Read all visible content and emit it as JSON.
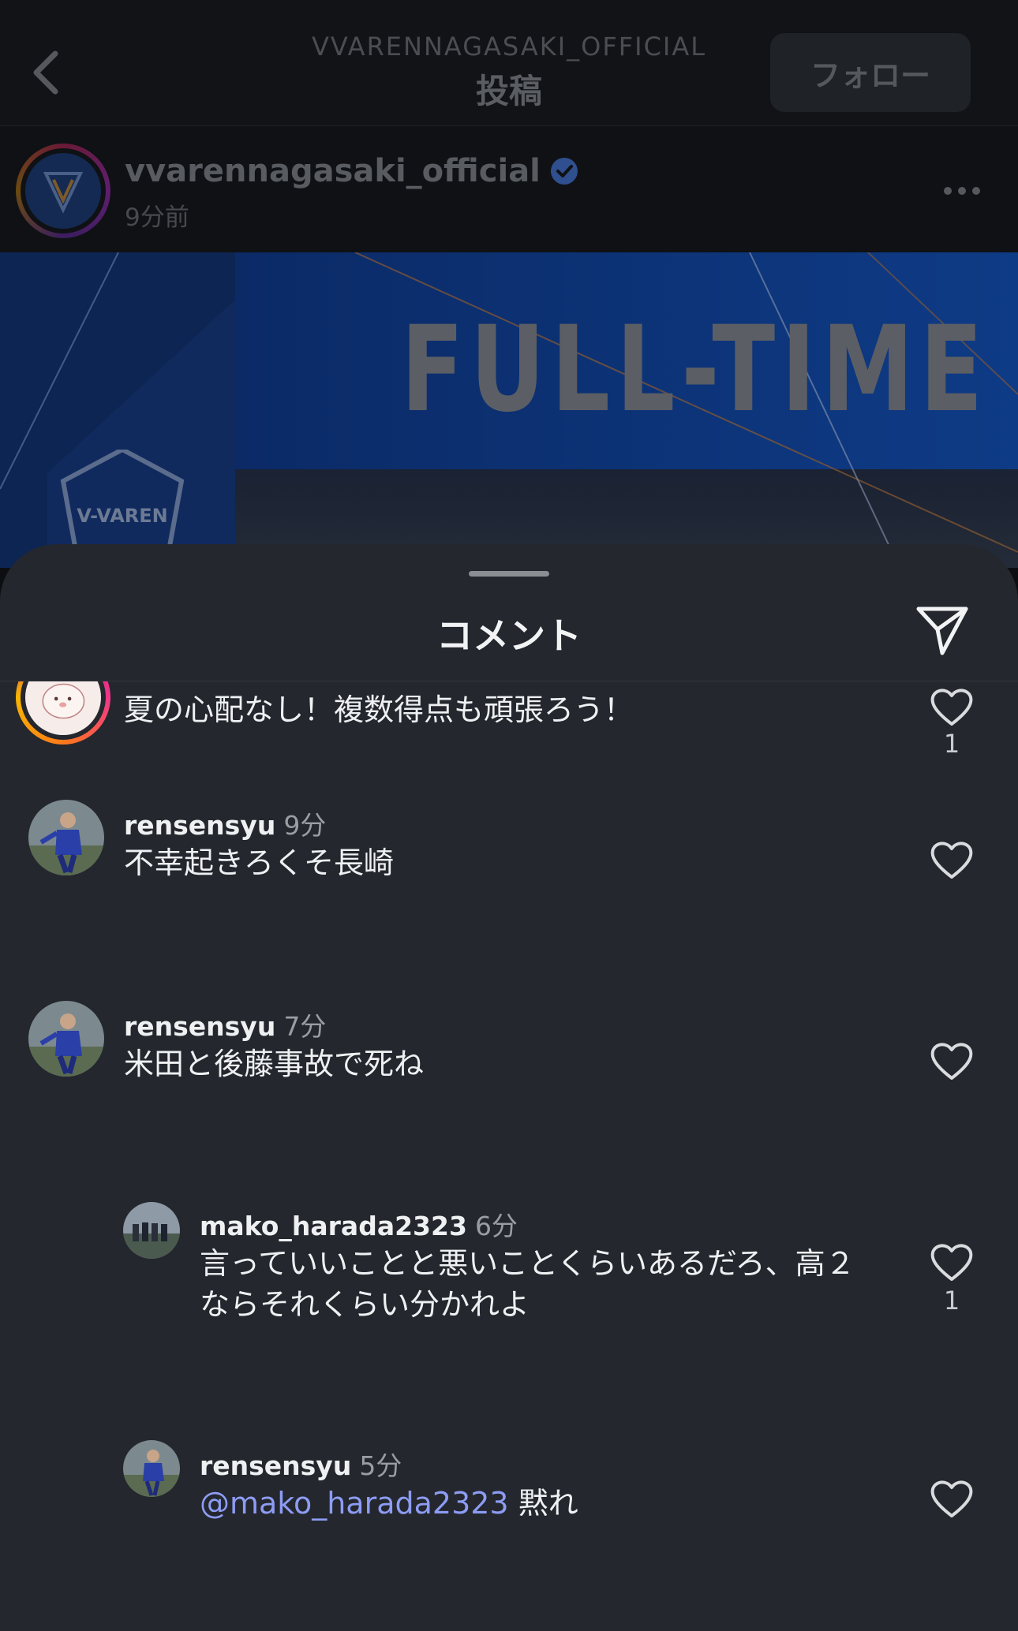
{
  "header": {
    "account": "VVARENNAGASAKI_OFFICIAL",
    "title": "投稿",
    "follow_label": "フォロー"
  },
  "post": {
    "username": "vvarennagasaki_official",
    "time": "9分前",
    "image_text": "FULL-TIME",
    "crest_text": "V-VAREN"
  },
  "sheet": {
    "title": "コメント"
  },
  "comments": [
    {
      "username": "",
      "time": "",
      "text": "夏の心配なし！複数得点も頑張ろう！",
      "likes": "1"
    },
    {
      "username": "rensensyu",
      "time": "9分",
      "text": "不幸起きろくそ長崎",
      "likes": ""
    },
    {
      "username": "rensensyu",
      "time": "7分",
      "text": "米田と後藤事故で死ね",
      "likes": ""
    },
    {
      "username": "mako_harada2323",
      "time": "6分",
      "text_line1": "言っていいことと悪いことくらいあるだろ、高２",
      "text_line2": "ならそれくらい分かれよ",
      "likes": "1"
    },
    {
      "username": "rensensyu",
      "time": "5分",
      "mention": "@mako_harada2323",
      "text": "黙れ",
      "likes": ""
    }
  ],
  "colors": {
    "sheet_bg": "#24272d",
    "mention": "#8d9cf4",
    "verified": "#3b6ee0"
  },
  "icons": [
    "back-chevron-icon",
    "verified-badge-icon",
    "more-icon",
    "share-send-icon",
    "heart-icon"
  ]
}
